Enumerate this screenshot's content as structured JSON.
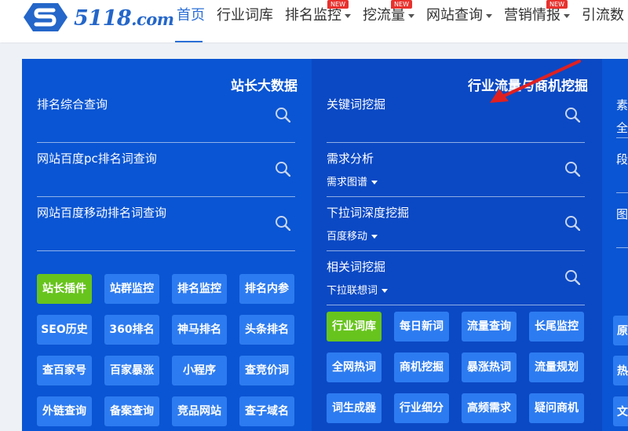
{
  "logo": {
    "name": "5118",
    "suffix": ".com"
  },
  "nav": [
    {
      "label": "首页",
      "active": true,
      "dropdown": false,
      "badge": ""
    },
    {
      "label": "行业词库",
      "active": false,
      "dropdown": false,
      "badge": ""
    },
    {
      "label": "排名监控",
      "active": false,
      "dropdown": true,
      "badge": "NEW"
    },
    {
      "label": "挖流量",
      "active": false,
      "dropdown": true,
      "badge": "NEW"
    },
    {
      "label": "网站查询",
      "active": false,
      "dropdown": true,
      "badge": ""
    },
    {
      "label": "营销情报",
      "active": false,
      "dropdown": true,
      "badge": "NEW"
    },
    {
      "label": "引流数",
      "active": false,
      "dropdown": false,
      "badge": ""
    }
  ],
  "columns": [
    {
      "title": "站长大数据",
      "queries": [
        {
          "label": "排名综合查询",
          "sub": ""
        },
        {
          "label": "网站百度pc排名词查询",
          "sub": ""
        },
        {
          "label": "网站百度移动排名词查询",
          "sub": ""
        }
      ],
      "buttons": [
        "站长插件",
        "站群监控",
        "排名监控",
        "排名内参",
        "SEO历史",
        "360排名",
        "神马排名",
        "头条排名",
        "查百家号",
        "百家暴涨",
        "小程序",
        "查竞价词",
        "外链查询",
        "备案查询",
        "竞品网站",
        "查子域名"
      ],
      "green_index": 0
    },
    {
      "title": "行业流量与商机挖掘",
      "queries": [
        {
          "label": "关键词挖掘",
          "sub": ""
        },
        {
          "label": "需求分析",
          "sub": "需求图谱"
        },
        {
          "label": "下拉词深度挖掘",
          "sub": "百度移动"
        },
        {
          "label": "相关词挖掘",
          "sub": "下拉联想词"
        }
      ],
      "buttons": [
        "行业词库",
        "每日新词",
        "流量查询",
        "长尾监控",
        "全网热词",
        "商机挖掘",
        "暴涨热词",
        "流量规划",
        "词生成器",
        "行业细分",
        "高频需求",
        "疑问商机"
      ],
      "green_index": 0
    }
  ],
  "col3": {
    "texts": [
      "素",
      "全",
      "段",
      "图"
    ],
    "buttons": [
      "原",
      "热",
      "文"
    ]
  }
}
